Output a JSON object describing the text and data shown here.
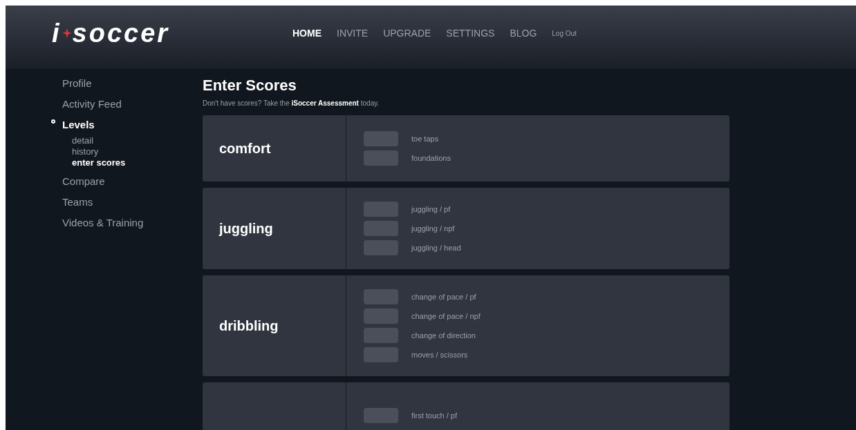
{
  "logo": {
    "prefix": "i",
    "name": "soccer"
  },
  "nav": [
    {
      "label": "HOME",
      "selected": true,
      "kind": "main"
    },
    {
      "label": "INVITE",
      "selected": false,
      "kind": "main"
    },
    {
      "label": "UPGRADE",
      "selected": false,
      "kind": "main"
    },
    {
      "label": "SETTINGS",
      "selected": false,
      "kind": "main"
    },
    {
      "label": "BLOG",
      "selected": false,
      "kind": "main"
    },
    {
      "label": "Log Out",
      "selected": false,
      "kind": "small"
    }
  ],
  "sidebar": {
    "items": [
      {
        "label": "Profile",
        "selected": false
      },
      {
        "label": "Activity Feed",
        "selected": false
      },
      {
        "label": "Levels",
        "selected": true,
        "children": [
          {
            "label": "detail",
            "selected": false
          },
          {
            "label": "history",
            "selected": false
          },
          {
            "label": "enter scores",
            "selected": true
          }
        ]
      },
      {
        "label": "Compare",
        "selected": false
      },
      {
        "label": "Teams",
        "selected": false
      },
      {
        "label": "Videos & Training",
        "selected": false
      }
    ]
  },
  "heading": "Enter Scores",
  "intro": {
    "before": "Don't have scores? Take the",
    "link": "iSoccer Assessment",
    "after": "today."
  },
  "categories": [
    {
      "title": "comfort",
      "items": [
        "toe taps",
        "foundations"
      ]
    },
    {
      "title": "juggling",
      "items": [
        "juggling / pf",
        "juggling / npf",
        "juggling / head"
      ]
    },
    {
      "title": "dribbling",
      "items": [
        "change of pace / pf",
        "change of pace / npf",
        "change of direction",
        "moves / scissors"
      ]
    },
    {
      "items": [
        "first touch / pf"
      ]
    }
  ]
}
